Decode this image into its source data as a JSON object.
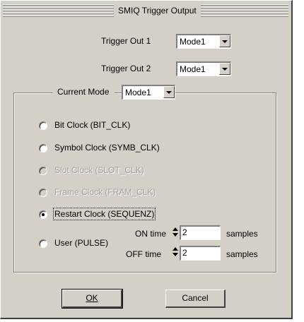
{
  "window": {
    "title": "SMIQ Trigger Output"
  },
  "trigger_out_1": {
    "label": "Trigger Out 1",
    "value": "Mode1"
  },
  "trigger_out_2": {
    "label": "Trigger Out 2",
    "value": "Mode1"
  },
  "current_mode": {
    "label": "Current Mode",
    "value": "Mode1"
  },
  "options": [
    {
      "label": "Bit Clock (BIT_CLK)",
      "enabled": true,
      "selected": false
    },
    {
      "label": "Symbol Clock (SYMB_CLK)",
      "enabled": true,
      "selected": false
    },
    {
      "label": "Slot Clock (SLOT_CLK)",
      "enabled": false,
      "selected": false
    },
    {
      "label": "Frame Clock (FRAM_CLK)",
      "enabled": false,
      "selected": false
    },
    {
      "label": "Restart Clock (SEQUENZ)",
      "enabled": true,
      "selected": true
    },
    {
      "label": "User (PULSE)",
      "enabled": true,
      "selected": false
    }
  ],
  "user_pulse": {
    "on_time_label": "ON time",
    "on_time_value": "2",
    "off_time_label": "OFF time",
    "off_time_value": "2",
    "unit": "samples"
  },
  "buttons": {
    "ok_label": "OK",
    "cancel_label": "Cancel"
  }
}
